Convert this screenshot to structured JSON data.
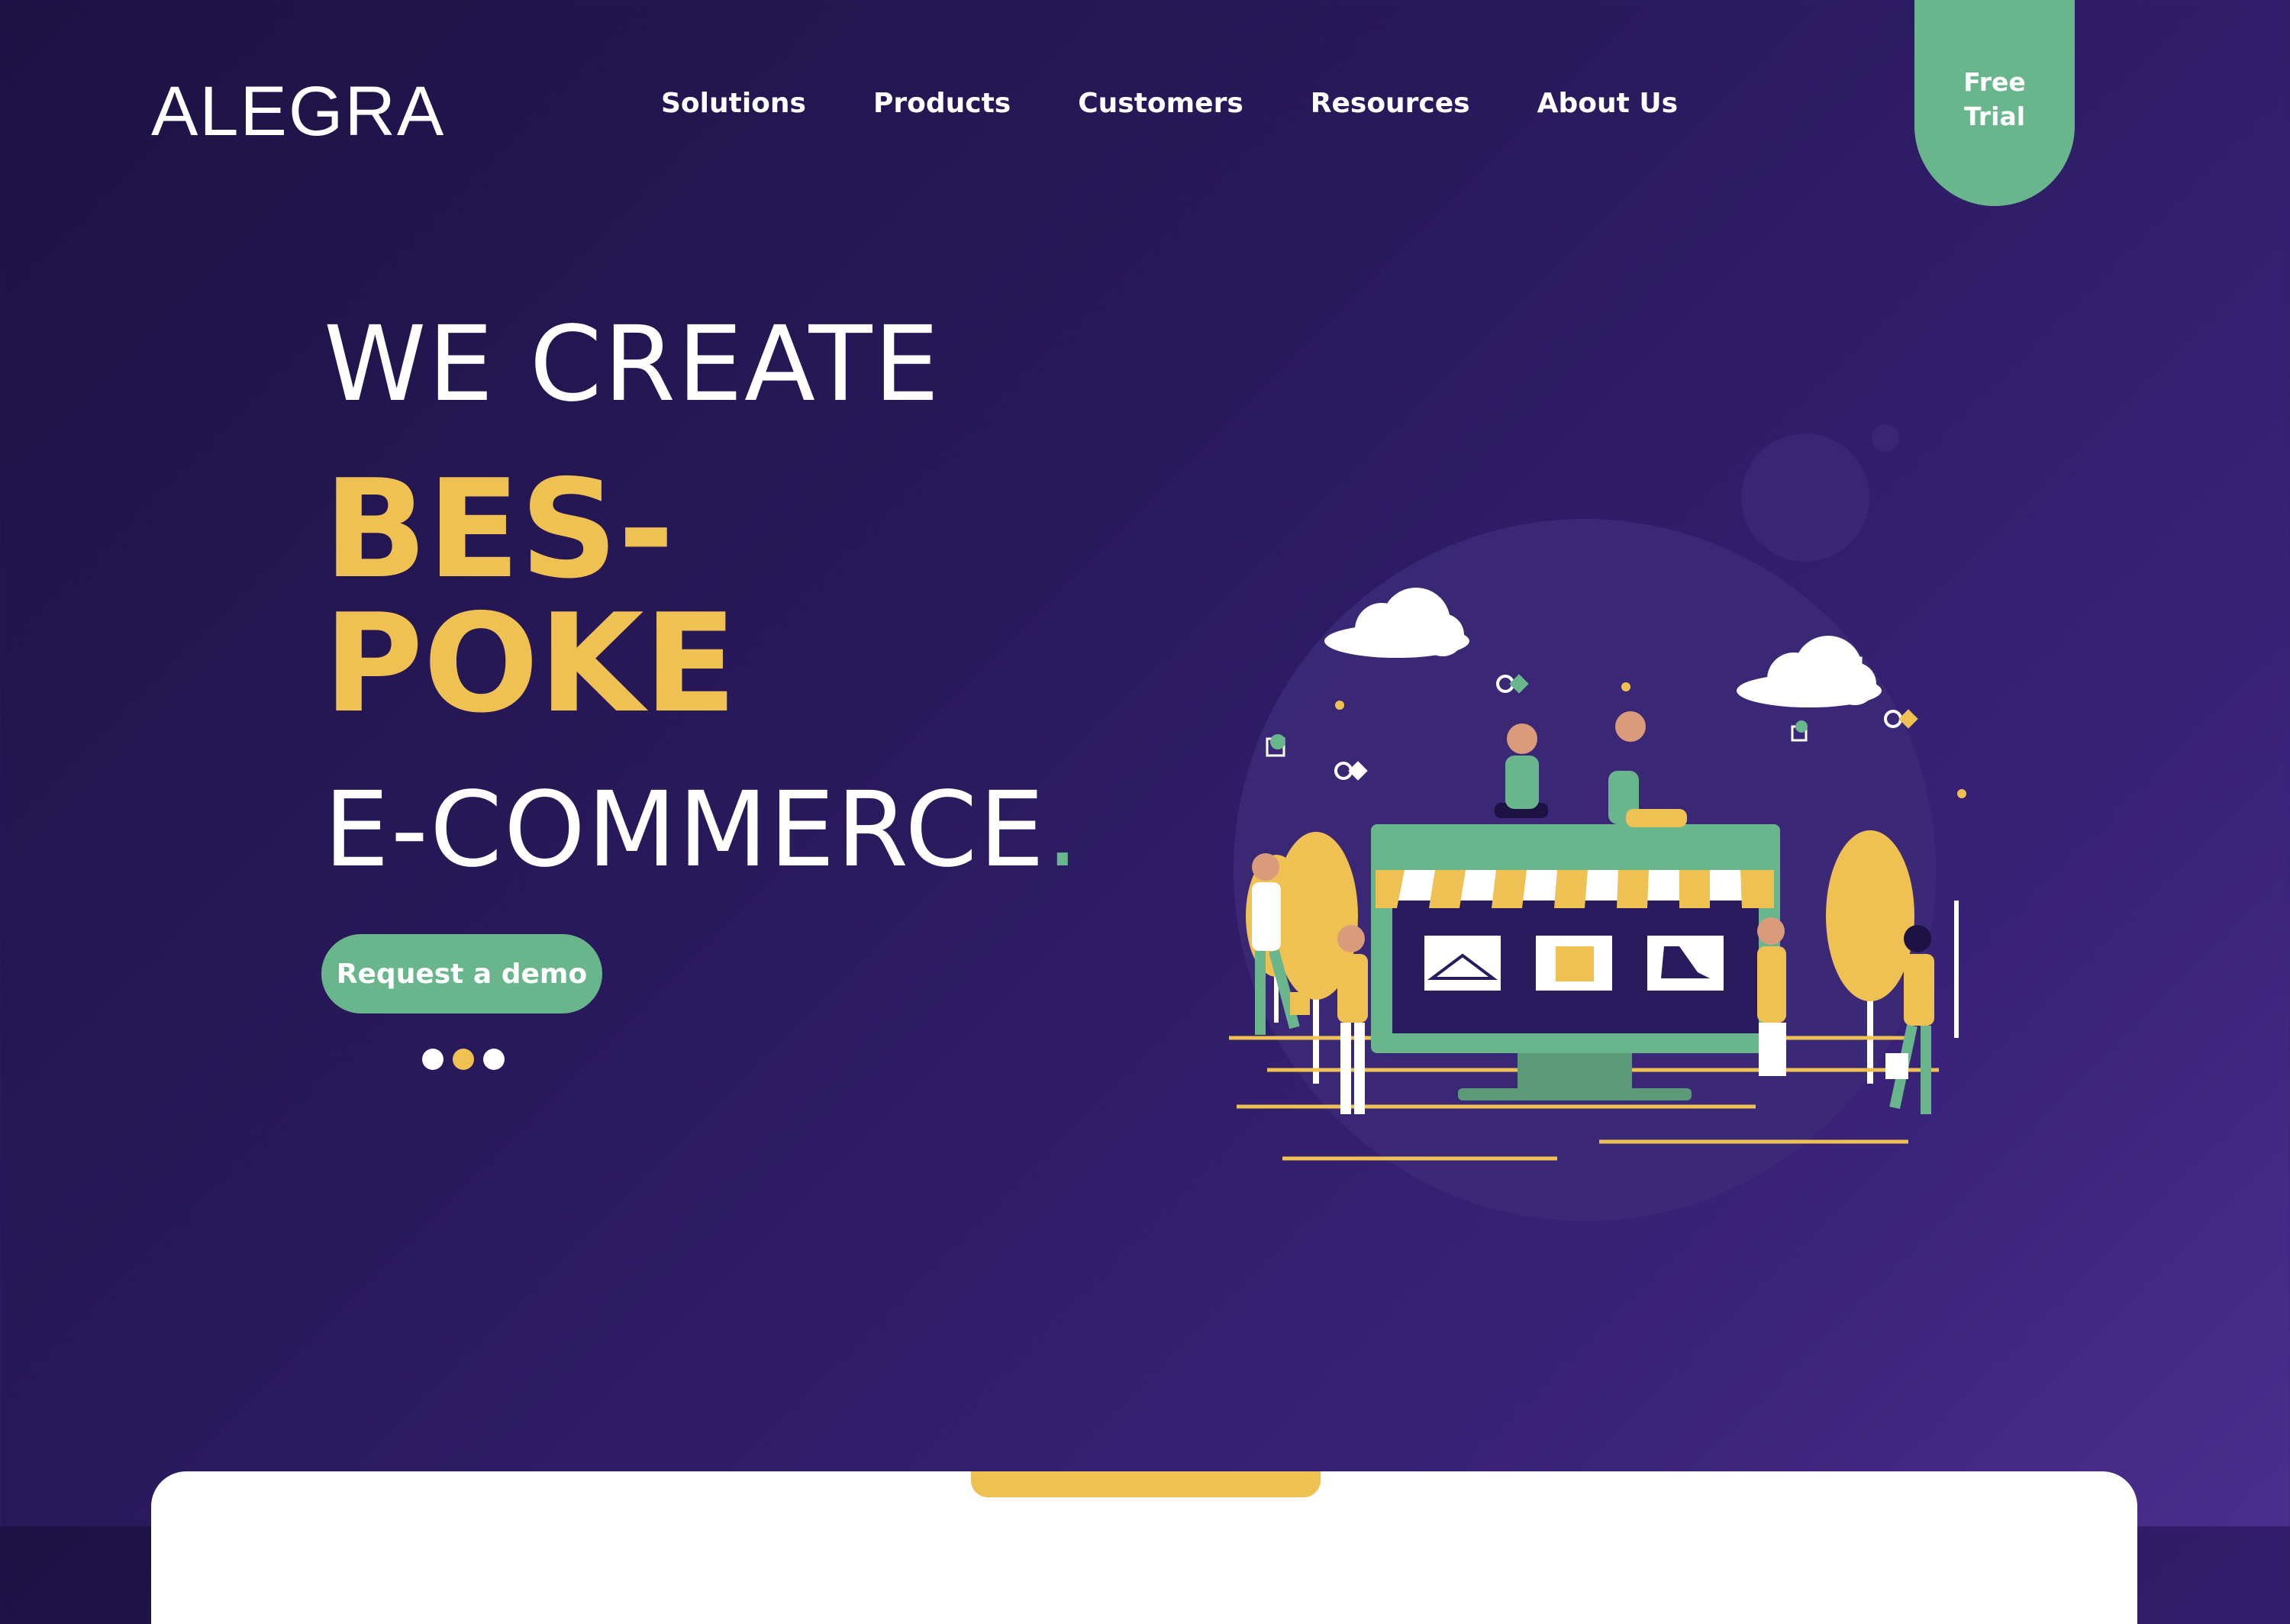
{
  "header": {
    "logo": "ALEGRA",
    "nav": [
      "Solutions",
      "Products",
      "Customers",
      "Resources",
      "About Us"
    ],
    "cta": {
      "line1": "Free",
      "line2": "Trial"
    }
  },
  "hero": {
    "line1": "WE CREATE",
    "highlight_line1": "BES-",
    "highlight_line2": "POKE",
    "line3": "E-COMMERCE",
    "line3_dot": ".",
    "button": "Request a demo",
    "carousel": {
      "count": 3,
      "active_index": 1
    }
  },
  "colors": {
    "accent_green": "#69b68d",
    "accent_yellow": "#efc052",
    "background_dark": "#1d1244",
    "background_light": "#4a2f8e"
  },
  "icons": [
    "hanger-icon",
    "gift-icon",
    "shoe-icon"
  ]
}
